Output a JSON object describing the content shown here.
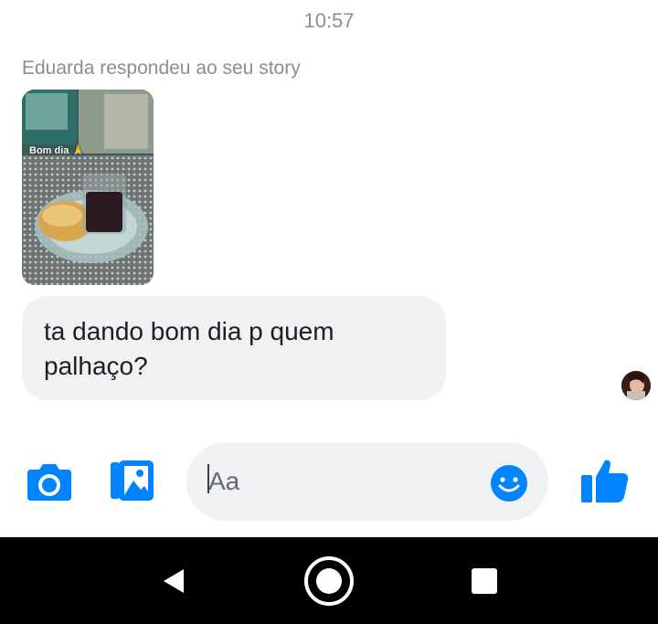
{
  "chat": {
    "timestamp": "10:57",
    "story_reply_label": "Eduarda respondeu ao seu story",
    "story_caption": "Bom dia 🙏",
    "message": "ta dando bom dia p quem\npalhaço?"
  },
  "composer": {
    "placeholder": "Aa",
    "icons": [
      "camera-icon",
      "gallery-icon",
      "emoji-icon",
      "thumbs-up-icon"
    ]
  },
  "navbar": {
    "icons": [
      "back-icon",
      "home-icon",
      "recent-apps-icon"
    ]
  },
  "colors": {
    "accent": "#0084ff",
    "bubble": "#f0f1f3",
    "meta_text": "#8a8d91",
    "navbar": "#000000"
  }
}
